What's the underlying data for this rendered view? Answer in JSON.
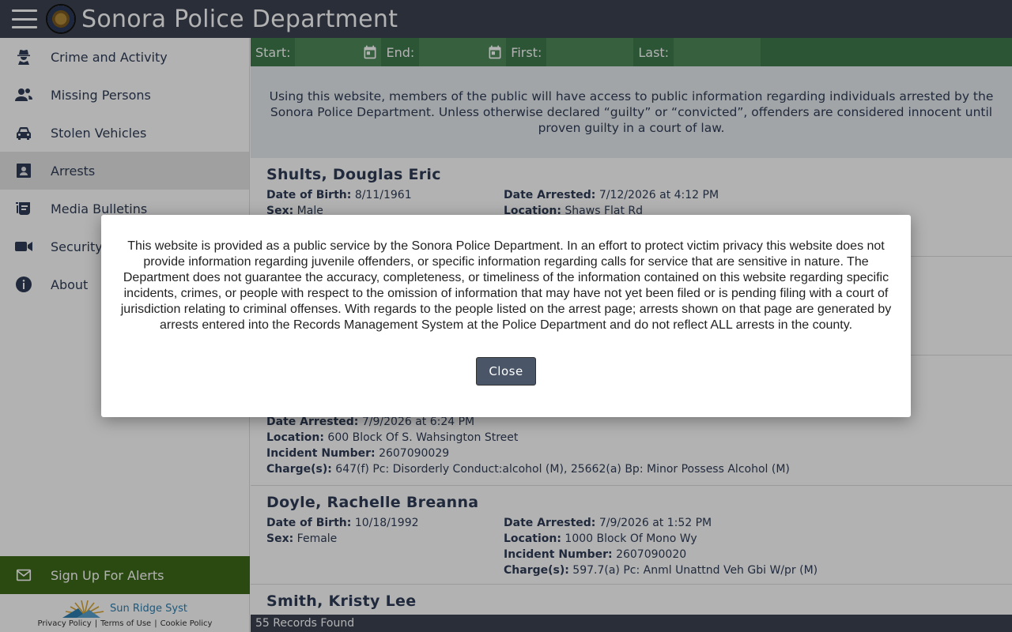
{
  "header": {
    "title": "Sonora Police Department"
  },
  "sidebar": {
    "items": [
      {
        "label": "Crime and Activity",
        "icon": "detective-icon"
      },
      {
        "label": "Missing Persons",
        "icon": "people-icon"
      },
      {
        "label": "Stolen Vehicles",
        "icon": "car-icon"
      },
      {
        "label": "Arrests",
        "icon": "id-badge-icon",
        "active": true
      },
      {
        "label": "Media Bulletins",
        "icon": "newspaper-icon"
      },
      {
        "label": "Security Cameras",
        "icon": "video-camera-icon"
      },
      {
        "label": "About",
        "icon": "info-icon"
      }
    ],
    "alerts_label": "Sign Up For Alerts",
    "brand_name": "Sun Ridge Syst",
    "links": {
      "privacy": "Privacy Policy",
      "terms": "Terms of Use",
      "cookie": "Cookie Policy",
      "sep": "|"
    }
  },
  "filters": {
    "start": "Start:",
    "end": "End:",
    "first": "First:",
    "last": "Last:"
  },
  "intro": "Using this website, members of the public will have access to public information regarding individuals arrested by the Sonora Police Department. Unless otherwise declared “guilty” or “convicted”, offenders are considered innocent until proven guilty in a court of law.",
  "labels": {
    "dob": "Date of Birth:",
    "sex": "Sex:",
    "arrested": "Date Arrested:",
    "location": "Location:",
    "incident": "Incident Number:",
    "charges": "Charge(s):"
  },
  "records": [
    {
      "name": "Shults, Douglas Eric",
      "dob": "8/11/1961",
      "sex": "Male",
      "arrested": "7/12/2026 at 4:12 PM",
      "location": "Shaws Flat Rd"
    },
    {
      "arrested": "7/9/2026 at 6:24 PM",
      "location": "600 Block Of S. Wahsington Street",
      "incident": "2607090029",
      "charges": "647(f) Pc: Disorderly Conduct:alcohol (M), 25662(a) Bp: Minor Possess Alcohol (M)"
    },
    {
      "name": "Doyle, Rachelle Breanna",
      "dob": "10/18/1992",
      "sex": "Female",
      "arrested": "7/9/2026 at 1:52 PM",
      "location": "1000 Block Of Mono Wy",
      "incident": "2607090020",
      "charges": "597.7(a) Pc: Anml Unattnd Veh Gbi W/pr (M)"
    },
    {
      "name": "Smith, Kristy Lee"
    }
  ],
  "status": "55 Records Found",
  "modal": {
    "text": "This website is provided as a public service by the Sonora Police Department. In an effort to protect victim privacy this website does not provide information regarding juvenile offenders, or specific information regarding calls for service that are sensitive in nature. The Department does not guarantee the accuracy, completeness, or timeliness of the information contained on this website regarding specific incidents, crimes, or people with respect to the omission of information that may have not yet been filed or is pending filing with a court of jurisdiction relating to criminal offenses. With regards to the people listed on the arrest page; arrests shown on that page are generated by arrests entered into the Records Management System at the Police Department and do not reflect ALL arrests in the county.",
    "close_label": "Close"
  },
  "colors": {
    "header": "#3b4252",
    "filterbar": "#3e7a4b",
    "alerts": "#3e6b1a",
    "text": "#2f3d57"
  }
}
